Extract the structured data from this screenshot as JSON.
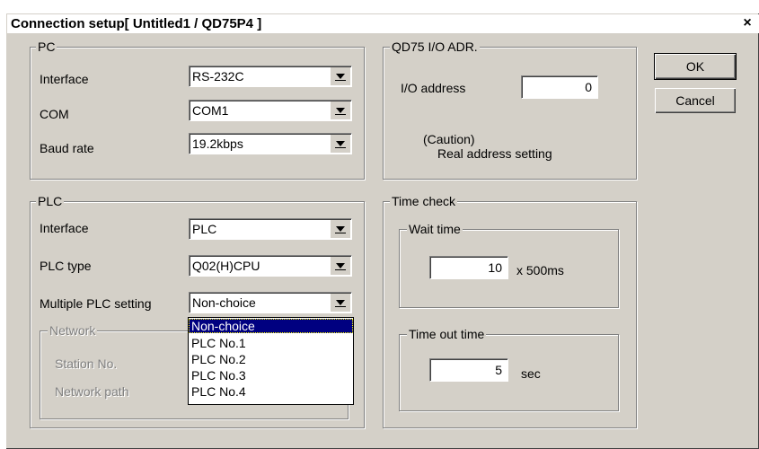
{
  "title": "Connection setup[ Untitled1 / QD75P4 ]",
  "close_glyph": "×",
  "pc": {
    "group_label": "PC",
    "interface_label": "Interface",
    "interface_value": "RS-232C",
    "com_label": "COM",
    "com_value": "COM1",
    "baud_label": "Baud rate",
    "baud_value": "19.2kbps"
  },
  "plc": {
    "group_label": "PLC",
    "interface_label": "Interface",
    "interface_value": "PLC",
    "type_label": "PLC type",
    "type_value": "Q02(H)CPU",
    "multiple_label": "Multiple PLC setting",
    "multiple_value": "Non-choice",
    "network_label": "Network",
    "station_label": "Station No.",
    "path_label": "Network path"
  },
  "multiple_options": [
    "Non-choice",
    "PLC No.1",
    "PLC No.2",
    "PLC No.3",
    "PLC No.4"
  ],
  "qd75": {
    "group_label": "QD75 I/O ADR.",
    "io_label": "I/O address",
    "io_value": "0",
    "caution_line1": "(Caution)",
    "caution_line2": "Real address setting"
  },
  "time_check": {
    "group_label": "Time check",
    "wait_label": "Wait time",
    "wait_value": "10",
    "wait_unit": "x 500ms",
    "timeout_label": "Time out time",
    "timeout_value": "5",
    "timeout_unit": "sec"
  },
  "buttons": {
    "ok": "OK",
    "cancel": "Cancel"
  }
}
